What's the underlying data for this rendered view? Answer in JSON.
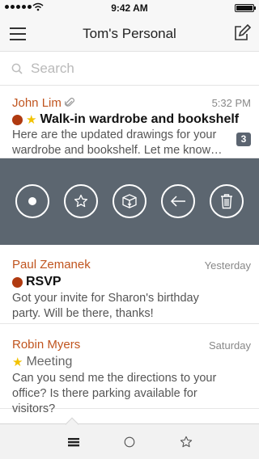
{
  "status_bar": {
    "time": "9:42 AM"
  },
  "nav": {
    "title": "Tom's Personal",
    "menu_icon": "hamburger-menu-icon",
    "compose_icon": "compose-icon"
  },
  "search": {
    "placeholder": "Search",
    "value": "",
    "icon": "search-icon"
  },
  "messages": [
    {
      "sender": "John Lim",
      "date": "5:32 PM",
      "subject": "Walk-in wardrobe and bookshelf",
      "preview": "Here are the updated drawings for your wardrobe and bookshelf. Let me know…",
      "thread_count": "3",
      "has_attachment": true,
      "flagged": true,
      "starred": true
    },
    {
      "sender": "Paul Zemanek",
      "date": "Yesterday",
      "subject": "RSVP",
      "preview": "Got your invite for Sharon's birthday party. Will be there, thanks!",
      "flagged": true,
      "starred": false
    },
    {
      "sender": "Robin Myers",
      "date": "Saturday",
      "subject": "Meeting",
      "preview": "Can you send me the directions to your office? Is there parking available for visitors?",
      "flagged": false,
      "starred": true
    }
  ],
  "swipe_actions": [
    "mark-unread-icon",
    "star-icon",
    "archive-box-icon",
    "reply-arrow-icon",
    "trash-icon"
  ],
  "tabs": [
    "inbox-list-icon",
    "circle-icon",
    "star-outline-icon"
  ],
  "colors": {
    "accent": "#c0541e",
    "flag": "#b03a10",
    "star": "#f2c200",
    "action_bar": "#5c6670",
    "badge": "#5b6470"
  }
}
